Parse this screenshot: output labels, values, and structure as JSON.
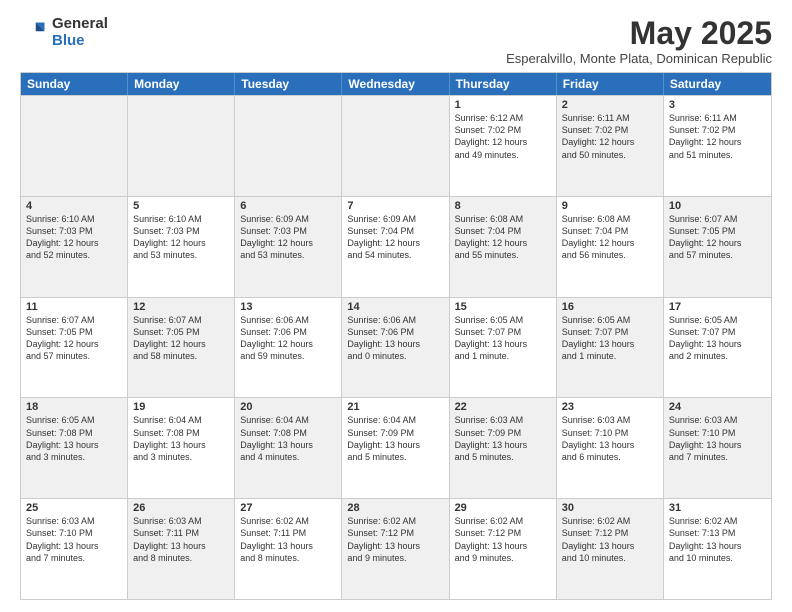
{
  "logo": {
    "general": "General",
    "blue": "Blue"
  },
  "title": "May 2025",
  "location": "Esperalvillo, Monte Plata, Dominican Republic",
  "weekdays": [
    "Sunday",
    "Monday",
    "Tuesday",
    "Wednesday",
    "Thursday",
    "Friday",
    "Saturday"
  ],
  "rows": [
    [
      {
        "day": "",
        "info": "",
        "shaded": true
      },
      {
        "day": "",
        "info": "",
        "shaded": true
      },
      {
        "day": "",
        "info": "",
        "shaded": true
      },
      {
        "day": "",
        "info": "",
        "shaded": true
      },
      {
        "day": "1",
        "info": "Sunrise: 6:12 AM\nSunset: 7:02 PM\nDaylight: 12 hours\nand 49 minutes."
      },
      {
        "day": "2",
        "info": "Sunrise: 6:11 AM\nSunset: 7:02 PM\nDaylight: 12 hours\nand 50 minutes.",
        "shaded": true
      },
      {
        "day": "3",
        "info": "Sunrise: 6:11 AM\nSunset: 7:02 PM\nDaylight: 12 hours\nand 51 minutes."
      }
    ],
    [
      {
        "day": "4",
        "info": "Sunrise: 6:10 AM\nSunset: 7:03 PM\nDaylight: 12 hours\nand 52 minutes.",
        "shaded": true
      },
      {
        "day": "5",
        "info": "Sunrise: 6:10 AM\nSunset: 7:03 PM\nDaylight: 12 hours\nand 53 minutes."
      },
      {
        "day": "6",
        "info": "Sunrise: 6:09 AM\nSunset: 7:03 PM\nDaylight: 12 hours\nand 53 minutes.",
        "shaded": true
      },
      {
        "day": "7",
        "info": "Sunrise: 6:09 AM\nSunset: 7:04 PM\nDaylight: 12 hours\nand 54 minutes."
      },
      {
        "day": "8",
        "info": "Sunrise: 6:08 AM\nSunset: 7:04 PM\nDaylight: 12 hours\nand 55 minutes.",
        "shaded": true
      },
      {
        "day": "9",
        "info": "Sunrise: 6:08 AM\nSunset: 7:04 PM\nDaylight: 12 hours\nand 56 minutes."
      },
      {
        "day": "10",
        "info": "Sunrise: 6:07 AM\nSunset: 7:05 PM\nDaylight: 12 hours\nand 57 minutes.",
        "shaded": true
      }
    ],
    [
      {
        "day": "11",
        "info": "Sunrise: 6:07 AM\nSunset: 7:05 PM\nDaylight: 12 hours\nand 57 minutes."
      },
      {
        "day": "12",
        "info": "Sunrise: 6:07 AM\nSunset: 7:05 PM\nDaylight: 12 hours\nand 58 minutes.",
        "shaded": true
      },
      {
        "day": "13",
        "info": "Sunrise: 6:06 AM\nSunset: 7:06 PM\nDaylight: 12 hours\nand 59 minutes."
      },
      {
        "day": "14",
        "info": "Sunrise: 6:06 AM\nSunset: 7:06 PM\nDaylight: 13 hours\nand 0 minutes.",
        "shaded": true
      },
      {
        "day": "15",
        "info": "Sunrise: 6:05 AM\nSunset: 7:07 PM\nDaylight: 13 hours\nand 1 minute."
      },
      {
        "day": "16",
        "info": "Sunrise: 6:05 AM\nSunset: 7:07 PM\nDaylight: 13 hours\nand 1 minute.",
        "shaded": true
      },
      {
        "day": "17",
        "info": "Sunrise: 6:05 AM\nSunset: 7:07 PM\nDaylight: 13 hours\nand 2 minutes."
      }
    ],
    [
      {
        "day": "18",
        "info": "Sunrise: 6:05 AM\nSunset: 7:08 PM\nDaylight: 13 hours\nand 3 minutes.",
        "shaded": true
      },
      {
        "day": "19",
        "info": "Sunrise: 6:04 AM\nSunset: 7:08 PM\nDaylight: 13 hours\nand 3 minutes."
      },
      {
        "day": "20",
        "info": "Sunrise: 6:04 AM\nSunset: 7:08 PM\nDaylight: 13 hours\nand 4 minutes.",
        "shaded": true
      },
      {
        "day": "21",
        "info": "Sunrise: 6:04 AM\nSunset: 7:09 PM\nDaylight: 13 hours\nand 5 minutes."
      },
      {
        "day": "22",
        "info": "Sunrise: 6:03 AM\nSunset: 7:09 PM\nDaylight: 13 hours\nand 5 minutes.",
        "shaded": true
      },
      {
        "day": "23",
        "info": "Sunrise: 6:03 AM\nSunset: 7:10 PM\nDaylight: 13 hours\nand 6 minutes."
      },
      {
        "day": "24",
        "info": "Sunrise: 6:03 AM\nSunset: 7:10 PM\nDaylight: 13 hours\nand 7 minutes.",
        "shaded": true
      }
    ],
    [
      {
        "day": "25",
        "info": "Sunrise: 6:03 AM\nSunset: 7:10 PM\nDaylight: 13 hours\nand 7 minutes."
      },
      {
        "day": "26",
        "info": "Sunrise: 6:03 AM\nSunset: 7:11 PM\nDaylight: 13 hours\nand 8 minutes.",
        "shaded": true
      },
      {
        "day": "27",
        "info": "Sunrise: 6:02 AM\nSunset: 7:11 PM\nDaylight: 13 hours\nand 8 minutes."
      },
      {
        "day": "28",
        "info": "Sunrise: 6:02 AM\nSunset: 7:12 PM\nDaylight: 13 hours\nand 9 minutes.",
        "shaded": true
      },
      {
        "day": "29",
        "info": "Sunrise: 6:02 AM\nSunset: 7:12 PM\nDaylight: 13 hours\nand 9 minutes."
      },
      {
        "day": "30",
        "info": "Sunrise: 6:02 AM\nSunset: 7:12 PM\nDaylight: 13 hours\nand 10 minutes.",
        "shaded": true
      },
      {
        "day": "31",
        "info": "Sunrise: 6:02 AM\nSunset: 7:13 PM\nDaylight: 13 hours\nand 10 minutes."
      }
    ]
  ]
}
